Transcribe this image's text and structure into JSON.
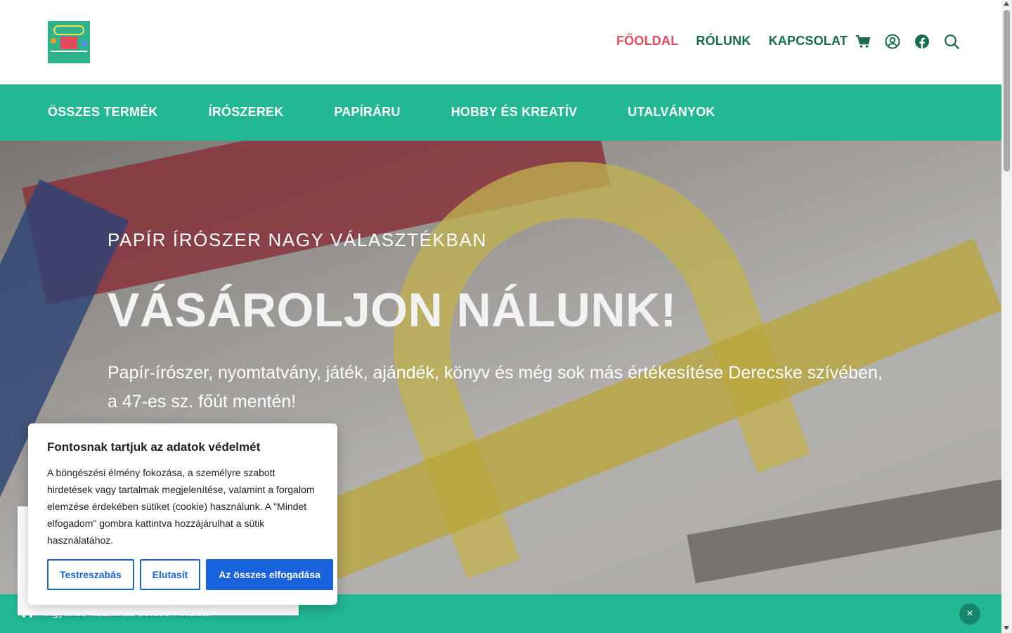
{
  "brand": {
    "logo_name": "Papír Írószer Játék Ajándék logo"
  },
  "topnav": {
    "items": [
      {
        "label": "FŐOLDAL"
      },
      {
        "label": "RÓLUNK"
      },
      {
        "label": "KAPCSOLAT"
      }
    ]
  },
  "header_icons": [
    "cart-icon",
    "account-icon",
    "facebook-icon",
    "search-icon"
  ],
  "catnav": {
    "items": [
      {
        "label": "ÖSSZES TERMÉK"
      },
      {
        "label": "ÍRÓSZEREK"
      },
      {
        "label": "PAPÍRÁRU"
      },
      {
        "label": "HOBBY ÉS KREATÍV"
      },
      {
        "label": "UTALVÁNYOK"
      }
    ]
  },
  "hero": {
    "eyebrow": "PAPÍR ÍRÓSZER NAGY VÁLASZTÉKBAN",
    "title": "VÁSÁROLJON NÁLUNK!",
    "lead": "Papír-írószer, nyomtatvány, játék, ajándék, könyv és még sok más értékesítése Derecske szívében, a 47-es sz. főút mentén!"
  },
  "cookie": {
    "title": "Fontosnak tartjuk az adatok védelmét",
    "text": "A böngészési élmény fokozása, a személyre szabott hirdetések vagy tartalmak megjelenítése, valamint a forgalom elemzése érdekében sütiket (cookie) használunk. A \"Mindet elfogadom\" gombra kattintva hozzájárulhat a sütik használatához.",
    "customize_label": "Testreszabás",
    "reject_label": "Elutasít",
    "accept_label": "Az összes elfogadása"
  },
  "bottombar": {
    "shipping_text": "Ingyenes kiszállítás 30.000 Ft felett!",
    "close_label": "×"
  },
  "colors": {
    "accent_green": "#22b893",
    "nav_dark_green": "#176b4f",
    "active_red": "#e24b5b",
    "button_blue": "#1863dc"
  }
}
